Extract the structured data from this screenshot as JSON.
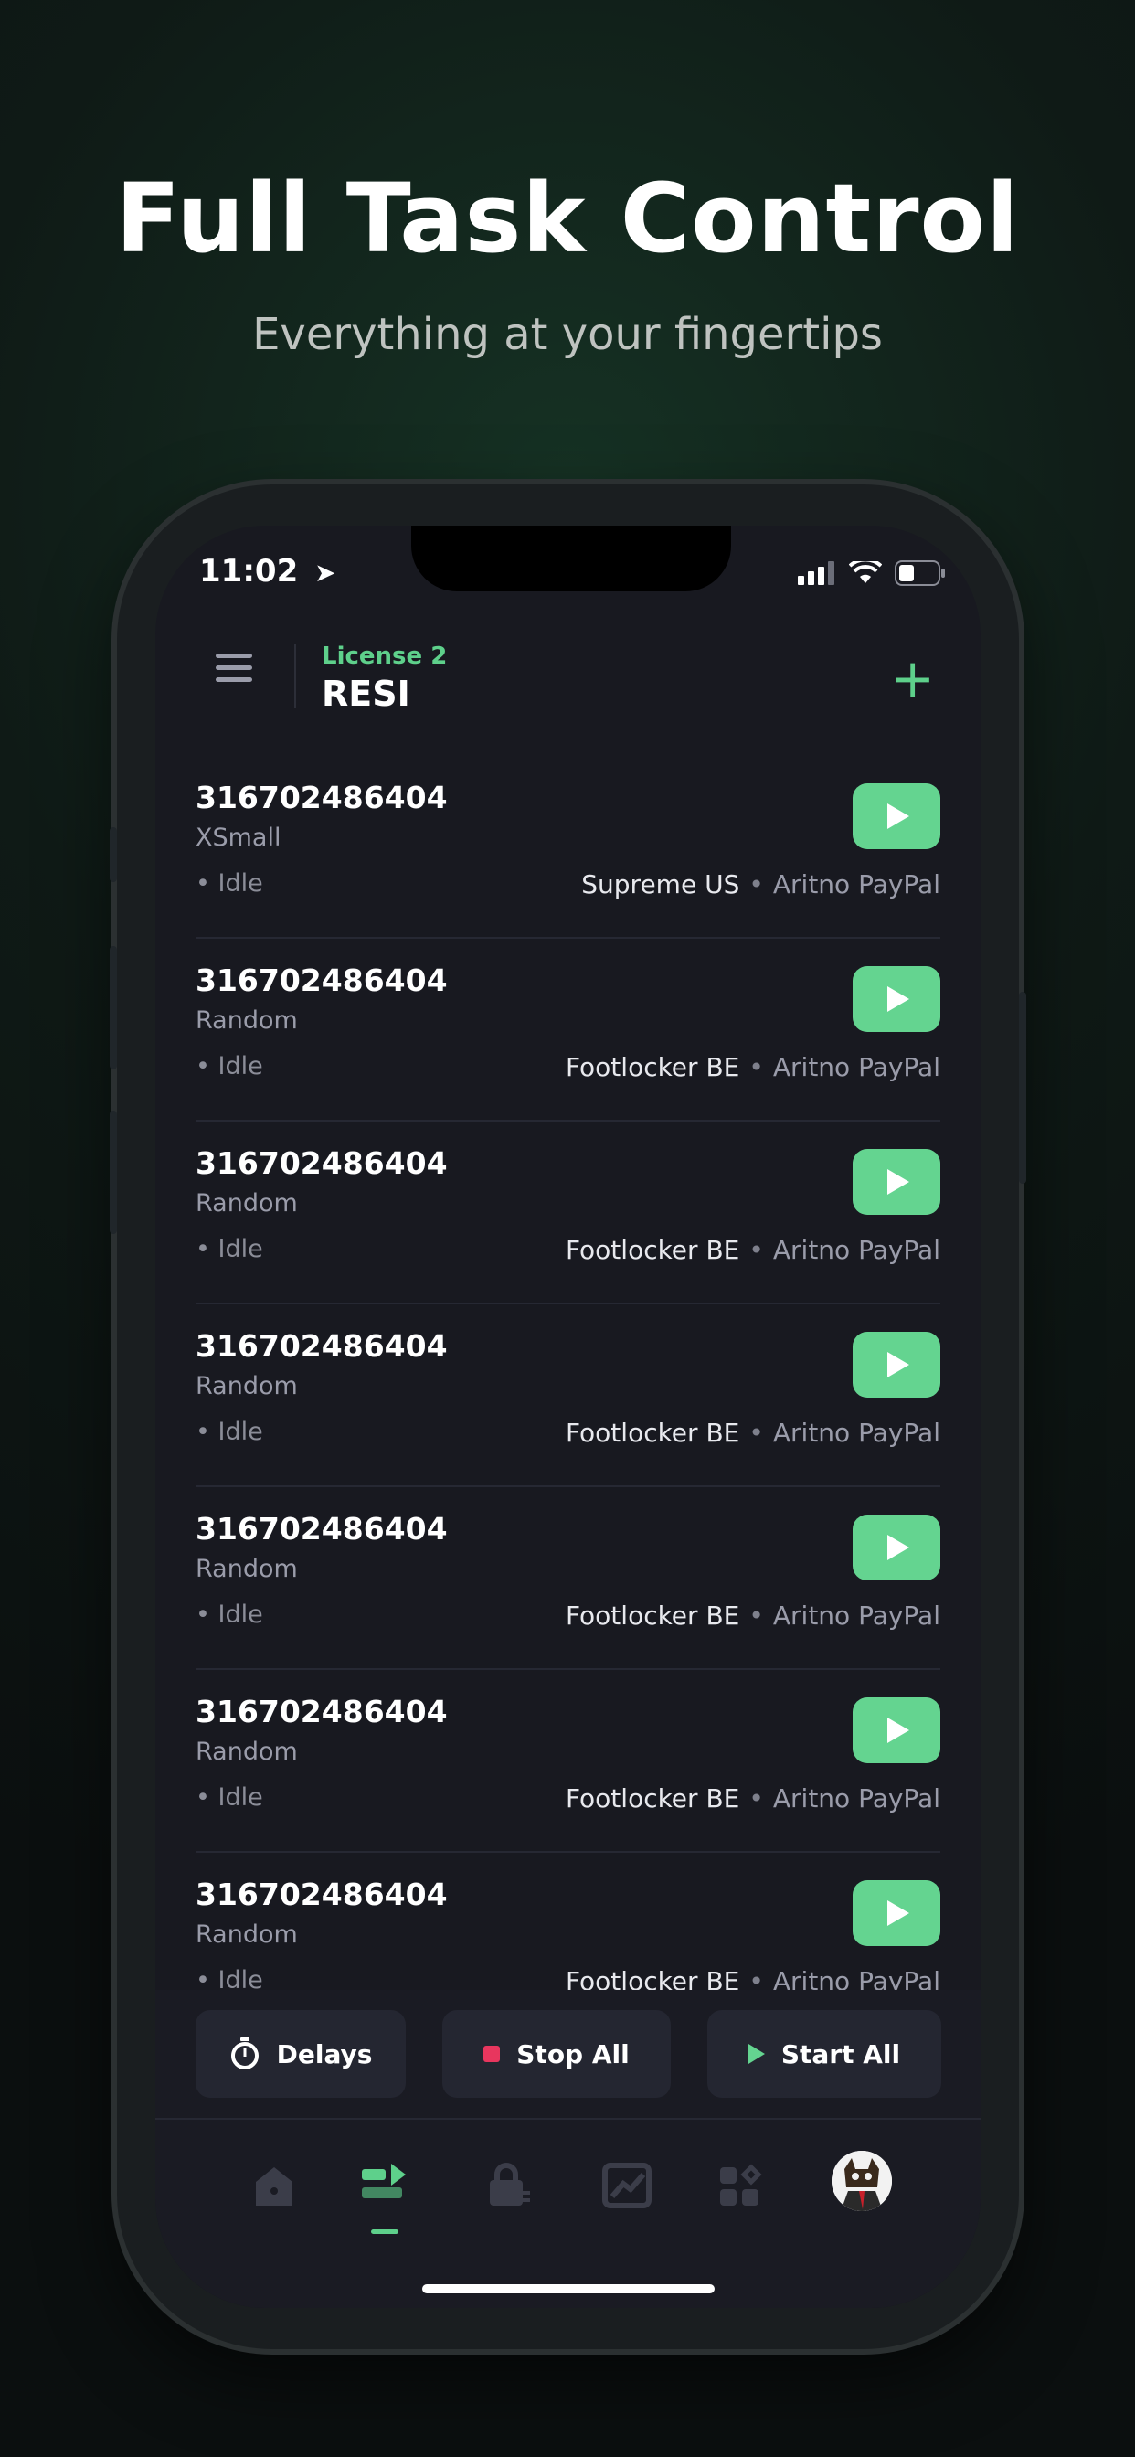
{
  "hero": {
    "title": "Full Task Control",
    "subtitle": "Everything at your fingertips"
  },
  "status_bar": {
    "time": "11:02"
  },
  "header": {
    "license": "License 2",
    "profile": "RESI"
  },
  "tasks": [
    {
      "id": "316702486404",
      "size": "XSmall",
      "status": "• Idle",
      "store": "Supreme US",
      "payment": "Aritno PayPal"
    },
    {
      "id": "316702486404",
      "size": "Random",
      "status": "• Idle",
      "store": "Footlocker BE",
      "payment": "Aritno PayPal"
    },
    {
      "id": "316702486404",
      "size": "Random",
      "status": "• Idle",
      "store": "Footlocker BE",
      "payment": "Aritno PayPal"
    },
    {
      "id": "316702486404",
      "size": "Random",
      "status": "• Idle",
      "store": "Footlocker BE",
      "payment": "Aritno PayPal"
    },
    {
      "id": "316702486404",
      "size": "Random",
      "status": "• Idle",
      "store": "Footlocker BE",
      "payment": "Aritno PayPal"
    },
    {
      "id": "316702486404",
      "size": "Random",
      "status": "• Idle",
      "store": "Footlocker BE",
      "payment": "Aritno PayPal"
    },
    {
      "id": "316702486404",
      "size": "Random",
      "status": "• Idle",
      "store": "Footlocker BE",
      "payment": "Aritno PayPal"
    }
  ],
  "actions": {
    "delays": "Delays",
    "stop_all": "Stop All",
    "start_all": "Start All"
  },
  "colors": {
    "accent": "#5ed08b",
    "stop": "#e8365e",
    "background": "#181920"
  },
  "tabs": [
    "home-icon",
    "tasks-icon",
    "profiles-icon",
    "analytics-icon",
    "tools-icon",
    "avatar"
  ]
}
